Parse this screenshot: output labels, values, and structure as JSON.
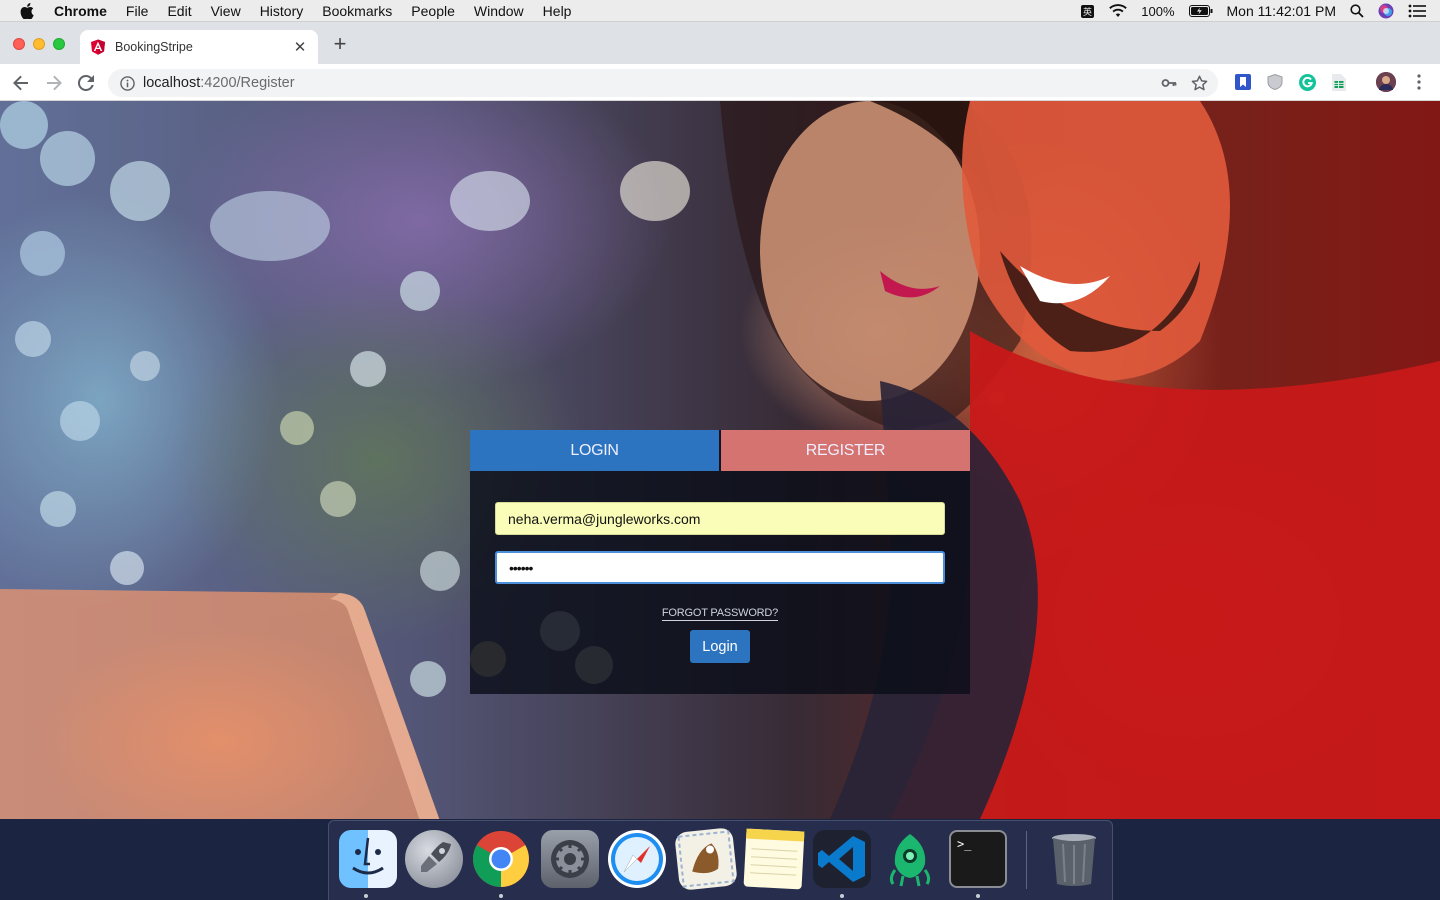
{
  "menubar": {
    "app_name": "Chrome",
    "items": [
      "File",
      "Edit",
      "View",
      "History",
      "Bookmarks",
      "People",
      "Window",
      "Help"
    ],
    "battery": "100%",
    "clock": "Mon 11:42:01 PM"
  },
  "browser": {
    "tab_title": "BookingStripe",
    "url_host": "localhost",
    "url_path": ":4200/Register"
  },
  "auth": {
    "tabs": [
      "LOGIN",
      "REGISTER"
    ],
    "active_tab": "LOGIN",
    "email_value": "neha.verma@jungleworks.com",
    "password_value": "••••••",
    "forgot_label": "FORGOT PASSWORD?",
    "login_button": "Login"
  },
  "colors": {
    "login_tab": "#2c74bf",
    "register_tab": "#d4736f",
    "email_autofill_bg": "#fafdb8",
    "focus_border": "#4b8ed9"
  },
  "dock": {
    "apps": [
      "finder-icon",
      "launchpad-icon",
      "chrome-icon",
      "system-preferences-icon",
      "safari-icon",
      "mail-icon",
      "notes-icon",
      "vscode-icon",
      "gitkraken-icon",
      "terminal-icon",
      "trash-icon"
    ],
    "running": [
      "finder-icon",
      "chrome-icon",
      "vscode-icon",
      "terminal-icon"
    ]
  }
}
